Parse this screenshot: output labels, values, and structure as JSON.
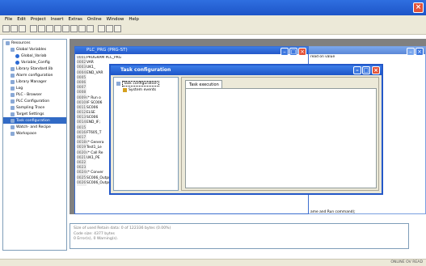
{
  "menu": [
    "File",
    "Edit",
    "Project",
    "Insert",
    "Extras",
    "Online",
    "Window",
    "Help"
  ],
  "tree": {
    "items": [
      {
        "label": "Resources",
        "indent": 0
      },
      {
        "label": "Global Variables",
        "indent": 1
      },
      {
        "label": "Global_Variab",
        "indent": 2
      },
      {
        "label": "Variable_Config",
        "indent": 2
      },
      {
        "label": "Library Standard.lib",
        "indent": 1
      },
      {
        "label": "Alarm configuration",
        "indent": 1
      },
      {
        "label": "Library Manager",
        "indent": 1
      },
      {
        "label": "Log",
        "indent": 1
      },
      {
        "label": "PLC - Browser",
        "indent": 1
      },
      {
        "label": "PLC Configuration",
        "indent": 1
      },
      {
        "label": "Sampling Trace",
        "indent": 1
      },
      {
        "label": "Target Settings",
        "indent": 1
      },
      {
        "label": "Task configuration",
        "indent": 1,
        "selected": true
      },
      {
        "label": "Watch- and Recipe",
        "indent": 1
      },
      {
        "label": "Workspace",
        "indent": 1
      }
    ]
  },
  "plc_window": {
    "title": "PLC_PRG (PRG-ST)",
    "lines": [
      {
        "n": "0001",
        "text": "PROGRAM PLC_PRG"
      },
      {
        "n": "0002",
        "text": "VAR"
      },
      {
        "n": "0003",
        "text": "   UK1_"
      },
      {
        "n": "0004",
        "text": "END_VAR"
      },
      {
        "n": "0005",
        "text": ""
      },
      {
        "n": "0006",
        "text": ""
      },
      {
        "n": "0007",
        "text": ""
      },
      {
        "n": "0008",
        "text": ""
      },
      {
        "n": "0009",
        "text": "(* Run o"
      },
      {
        "n": "0010",
        "text": "IF SC006"
      },
      {
        "n": "0011",
        "text": "   SC006"
      },
      {
        "n": "0012",
        "text": "ELSE"
      },
      {
        "n": "0013",
        "text": "   SC006"
      },
      {
        "n": "0014",
        "text": "END_IF;"
      },
      {
        "n": "0015",
        "text": ""
      },
      {
        "n": "0016",
        "text": "FT605_T"
      },
      {
        "n": "0017",
        "text": ""
      },
      {
        "n": "0018",
        "text": "(* Genera"
      },
      {
        "n": "0019",
        "text": "Test1_Le"
      },
      {
        "n": "0020",
        "text": "(* Call Re"
      },
      {
        "n": "0021",
        "text": "UK1_PE"
      },
      {
        "n": "0022",
        "text": ""
      },
      {
        "n": "0023",
        "text": ""
      },
      {
        "n": "0024",
        "text": "(* Conver"
      },
      {
        "n": "0025",
        "text": "SC006_Output_Speed_Ref_Word:=Dwor(Real_TO_WORD(SC006_SetSpeed*1.0));"
      },
      {
        "n": "0026",
        "text": "SC006_Output_Raw_Bytes:=F(Value_To_Bytes(CV004_PVvalue));"
      }
    ]
  },
  "right_window": {
    "lines": [
      "read on value",
      "",
      "",
      "",
      "Bx : Float + Bno ;",
      "3);",
      "",
      "",
      "",
      "",
      "",
      "",
      "",
      "",
      "",
      "",
      "",
      "",
      "",
      "",
      "",
      "",
      "",
      "",
      "",
      "",
      "",
      "",
      "",
      "",
      "",
      "ame and Run command);",
      "ast REAL;",
      "al);"
    ]
  },
  "task_window": {
    "title": "Task configuration",
    "tree": [
      {
        "label": "Task configuration",
        "indent": 0,
        "selected": true
      },
      {
        "label": "System events",
        "indent": 1
      }
    ],
    "tab_label": "Task execution"
  },
  "messages": [
    "Size of used Retain data: 0 of 122336 bytes (0.00%)",
    "Code size: 4377 bytes",
    "0 Error(s), 0 Warning(s)."
  ],
  "status": {
    "right": "ONLINE  OV  READ"
  },
  "colors": {
    "title_blue": "#1d55c8",
    "close_red": "#e2533a",
    "bg_gray": "#ece9d8",
    "mdi_gray": "#808080"
  }
}
